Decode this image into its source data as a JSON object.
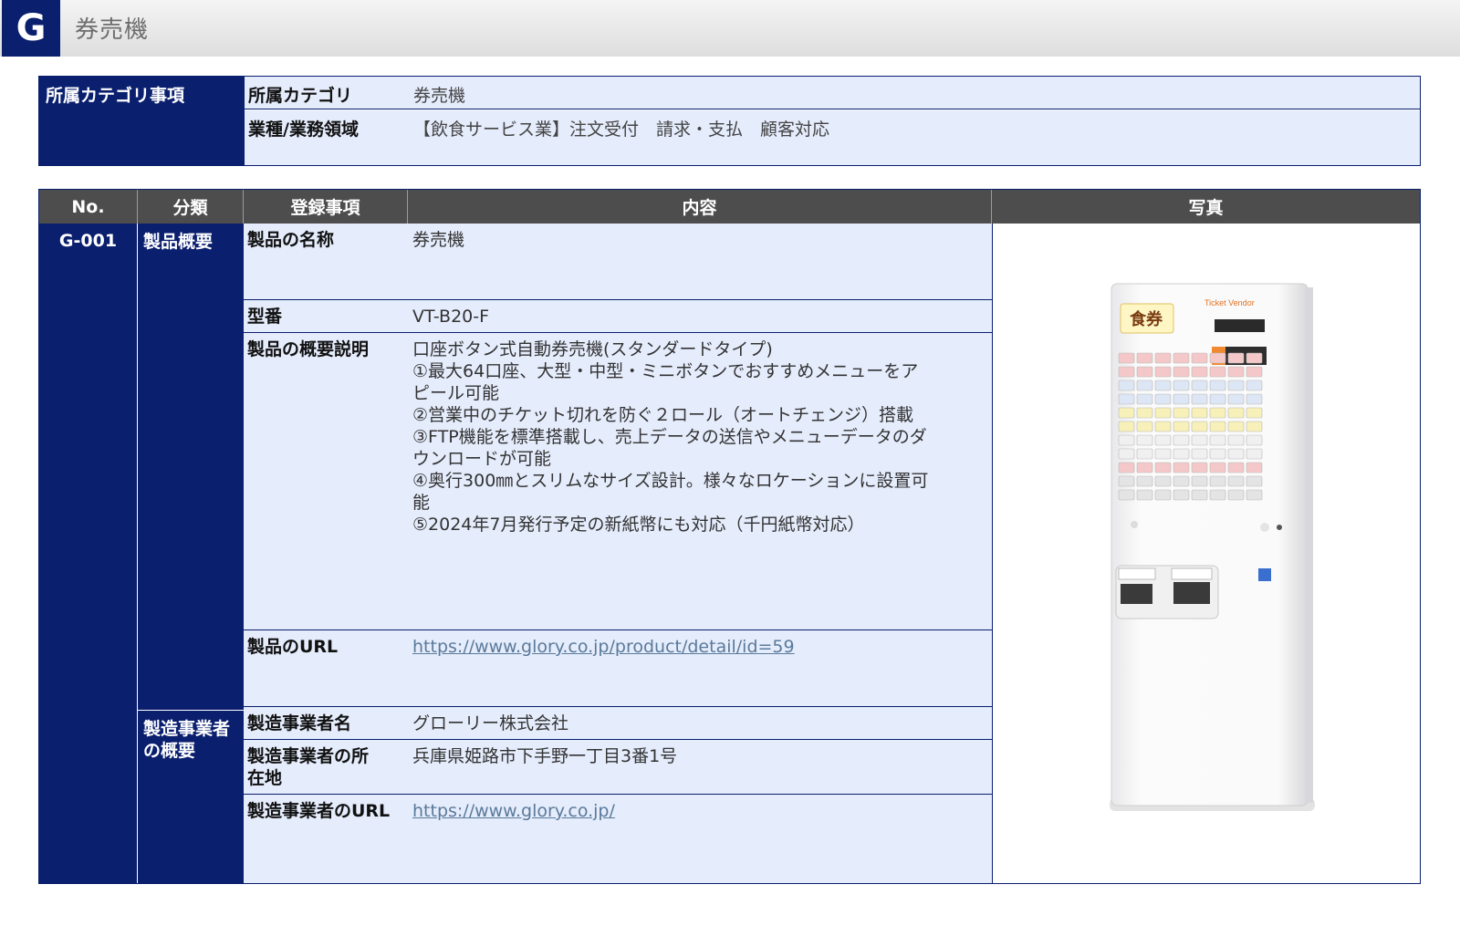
{
  "header": {
    "letter": "G",
    "title": "券売機"
  },
  "category": {
    "heading": "所属カテゴリ事項",
    "rows": [
      {
        "label": "所属カテゴリ",
        "value": "券売機"
      },
      {
        "label": "業種/業務領域",
        "value": "【飲食サービス業】注文受付　請求・支払　顧客対応"
      }
    ]
  },
  "table": {
    "headers": {
      "no": "No.",
      "cls": "分類",
      "item": "登録事項",
      "content": "内容",
      "photo": "写真"
    },
    "no": "G-001",
    "groups": {
      "product": "製品概要",
      "maker": "製造事業者の概要"
    },
    "rows": {
      "name": {
        "label": "製品の名称",
        "value": "券売機"
      },
      "model": {
        "label": "型番",
        "value": "VT-B20-F"
      },
      "desc": {
        "label": "製品の概要説明",
        "lines": [
          "口座ボタン式自動券売機(スタンダードタイプ)",
          "①最大64口座、大型・中型・ミニボタンでおすすめメニューをア",
          "ピール可能",
          "②営業中のチケット切れを防ぐ２ロール（オートチェンジ）搭載",
          "③FTP機能を標準搭載し、売上データの送信やメニューデータのダ",
          "ウンロードが可能",
          "④奥行300㎜とスリムなサイズ設計。様々なロケーションに設置可",
          "能",
          "⑤2024年7月発行予定の新紙幣にも対応（千円紙幣対応）"
        ]
      },
      "url": {
        "label": "製品のURL",
        "value": "https://www.glory.co.jp/product/detail/id=59"
      },
      "maker_name": {
        "label": "製造事業者名",
        "value": "グローリー株式会社"
      },
      "maker_addr": {
        "label": "製造事業者の所在地",
        "value": "兵庫県姫路市下手野一丁目3番1号"
      },
      "maker_url": {
        "label": "製造事業者のURL",
        "value": "https://www.glory.co.jp/"
      }
    },
    "photo": {
      "sign_food": "食券",
      "sign_brand": "Ticket Vendor"
    }
  }
}
